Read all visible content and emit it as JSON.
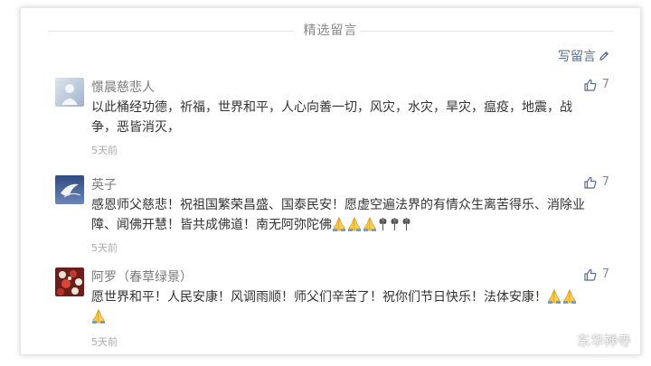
{
  "header": {
    "title": "精选留言",
    "write_label": "写留言"
  },
  "comments": [
    {
      "nickname": "憬晨慈悲人",
      "text": "以此桶经功德，祈福，世界和平，人心向善一切，风灾，水灾，旱灾，瘟疫，地震，战争，恶皆消灭，",
      "time": "5天前",
      "likes": "7",
      "avatar_icon": "avatar-silhouette"
    },
    {
      "nickname": "英子",
      "text": "感恩师父慈悲！祝祖国繁荣昌盛、国泰民安！愿虚空遍法界的有情众生离苦得乐、消除业障、闻佛开慧！皆共成佛道！南无阿弥陀佛",
      "emojis": [
        "pray-icon",
        "pray-icon",
        "pray-icon",
        "wheat-icon",
        "wheat-icon",
        "wheat-icon"
      ],
      "time": "5天前",
      "likes": "7",
      "avatar_icon": "avatar-bird"
    },
    {
      "nickname": "阿罗（春草绿景）",
      "text": "愿世界和平！人民安康！风调雨顺！师父们辛苦了！祝你们节日快乐！法体安康！",
      "emojis": [
        "pray-icon",
        "pray-icon",
        "pray-icon"
      ],
      "time": "5天前",
      "likes": "7",
      "avatar_icon": "avatar-flowers"
    }
  ],
  "watermark": {
    "text": "东华禅寺"
  },
  "colors": {
    "link": "#576b95",
    "nickname": "#7b7b7b",
    "content": "#333333",
    "time": "#aaaaaa"
  }
}
